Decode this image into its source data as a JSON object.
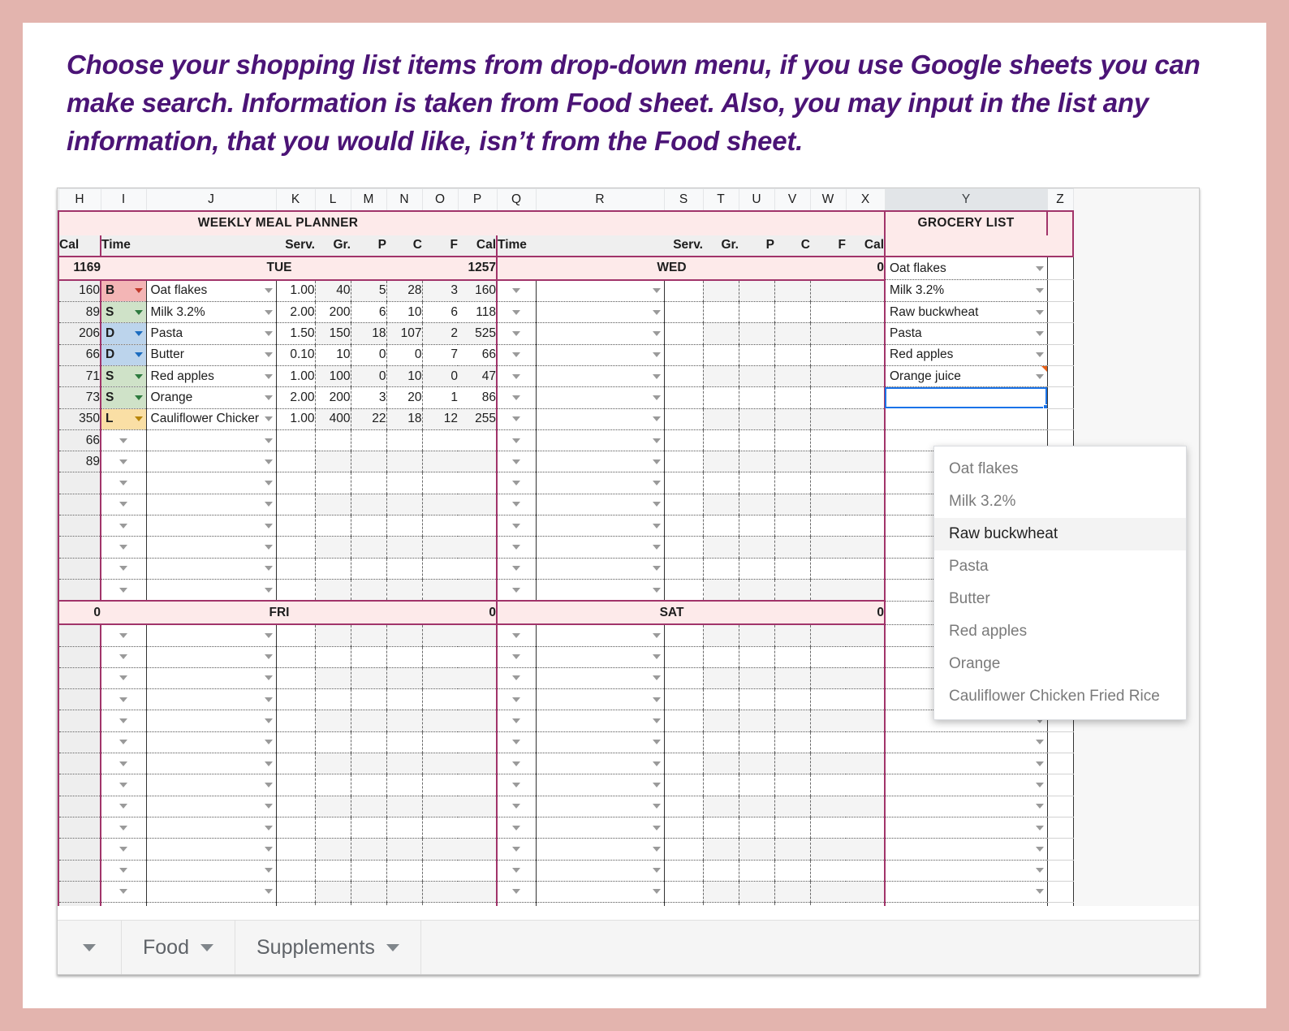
{
  "caption": "Choose your shopping list items from drop-down menu, if you use Google sheets you can make search. Information is taken from Food sheet. Also, you may input in the list any information, that you would like, isn’t from the Food sheet.",
  "spreadsheet": {
    "column_letters": [
      "H",
      "I",
      "J",
      "K",
      "L",
      "M",
      "N",
      "O",
      "P",
      "Q",
      "R",
      "S",
      "T",
      "U",
      "V",
      "W",
      "X",
      "Y",
      "Z"
    ],
    "selected_column": "Y",
    "titles": {
      "planner": "WEEKLY MEAL PLANNER",
      "grocery": "GROCERY LIST"
    },
    "headers_left": [
      "Cal",
      "Time",
      "",
      "Serv.",
      "Gr.",
      "P",
      "C",
      "F",
      "Cal"
    ],
    "headers_right": [
      "Time",
      "",
      "Serv.",
      "Gr.",
      "P",
      "C",
      "F",
      "Cal"
    ],
    "days": {
      "tue": {
        "label": "TUE",
        "cal_left": "1169",
        "cal_right": "1257"
      },
      "wed": {
        "label": "WED",
        "cal_right": "0"
      },
      "fri": {
        "label": "FRI",
        "cal_left": "0",
        "cal_right": "0"
      },
      "sat": {
        "label": "SAT",
        "cal_right": "0"
      }
    },
    "tue_rows": [
      {
        "cal": "160",
        "time": "B",
        "time_color": "#f3b5b5",
        "arrow": "red",
        "food": "Oat flakes",
        "serv": "1.00",
        "gr": "40",
        "p": "5",
        "c": "28",
        "f": "3",
        "kcal": "160"
      },
      {
        "cal": "89",
        "time": "S",
        "time_color": "#cfe2c8",
        "arrow": "green",
        "food": "Milk 3.2%",
        "serv": "2.00",
        "gr": "200",
        "p": "6",
        "c": "10",
        "f": "6",
        "kcal": "118"
      },
      {
        "cal": "206",
        "time": "D",
        "time_color": "#bcd4ec",
        "arrow": "blue",
        "food": "Pasta",
        "serv": "1.50",
        "gr": "150",
        "p": "18",
        "c": "107",
        "f": "2",
        "kcal": "525"
      },
      {
        "cal": "66",
        "time": "D",
        "time_color": "#bcd4ec",
        "arrow": "blue",
        "food": "Butter",
        "serv": "0.10",
        "gr": "10",
        "p": "0",
        "c": "0",
        "f": "7",
        "kcal": "66"
      },
      {
        "cal": "71",
        "time": "S",
        "time_color": "#cfe2c8",
        "arrow": "green",
        "food": "Red apples",
        "serv": "1.00",
        "gr": "100",
        "p": "0",
        "c": "10",
        "f": "0",
        "kcal": "47"
      },
      {
        "cal": "73",
        "time": "S",
        "time_color": "#cfe2c8",
        "arrow": "green",
        "food": "Orange",
        "serv": "2.00",
        "gr": "200",
        "p": "3",
        "c": "20",
        "f": "1",
        "kcal": "86"
      },
      {
        "cal": "350",
        "time": "L",
        "time_color": "#fadfa5",
        "arrow": "gold",
        "food": "Cauliflower Chicker",
        "serv": "1.00",
        "gr": "400",
        "p": "22",
        "c": "18",
        "f": "12",
        "kcal": "255"
      },
      {
        "cal": "66",
        "time": "",
        "arrow": "grey",
        "food": "",
        "serv": "",
        "gr": "",
        "p": "",
        "c": "",
        "f": "",
        "kcal": ""
      },
      {
        "cal": "89",
        "time": "",
        "arrow": "grey",
        "food": "",
        "serv": "",
        "gr": "",
        "p": "",
        "c": "",
        "f": "",
        "kcal": ""
      },
      {
        "cal": "",
        "time": "",
        "arrow": "grey",
        "food": "",
        "serv": "",
        "gr": "",
        "p": "",
        "c": "",
        "f": "",
        "kcal": ""
      },
      {
        "cal": "",
        "time": "",
        "arrow": "grey",
        "food": "",
        "serv": "",
        "gr": "",
        "p": "",
        "c": "",
        "f": "",
        "kcal": ""
      },
      {
        "cal": "",
        "time": "",
        "arrow": "grey",
        "food": "",
        "serv": "",
        "gr": "",
        "p": "",
        "c": "",
        "f": "",
        "kcal": ""
      },
      {
        "cal": "",
        "time": "",
        "arrow": "grey",
        "food": "",
        "serv": "",
        "gr": "",
        "p": "",
        "c": "",
        "f": "",
        "kcal": ""
      },
      {
        "cal": "",
        "time": "",
        "arrow": "grey",
        "food": "",
        "serv": "",
        "gr": "",
        "p": "",
        "c": "",
        "f": "",
        "kcal": ""
      },
      {
        "cal": "",
        "time": "",
        "arrow": "grey",
        "food": "",
        "serv": "",
        "gr": "",
        "p": "",
        "c": "",
        "f": "",
        "kcal": ""
      }
    ],
    "grocery_list": [
      {
        "name": "Oat flakes",
        "note": false
      },
      {
        "name": "Milk 3.2%",
        "note": false
      },
      {
        "name": "Raw buckwheat",
        "note": false
      },
      {
        "name": "Pasta",
        "note": false
      },
      {
        "name": "Red apples",
        "note": false
      },
      {
        "name": "Orange juice",
        "note": true
      },
      {
        "name": "",
        "note": false,
        "selected": true
      }
    ],
    "dropdown": {
      "open": true,
      "highlighted": "Raw buckwheat",
      "options": [
        "Oat flakes",
        "Milk 3.2%",
        "Raw buckwheat",
        "Pasta",
        "Butter",
        "Red apples",
        "Orange",
        "Cauliflower Chicken Fried Rice"
      ]
    },
    "sheet_tabs": [
      "Food",
      "Supplements"
    ],
    "colors": {
      "accent_border": "#a1346a",
      "band_pink": "#fdeaea",
      "selection_blue": "#1a73e8",
      "page_background": "#e3b4ae",
      "caption_text": "#4b1476"
    }
  }
}
